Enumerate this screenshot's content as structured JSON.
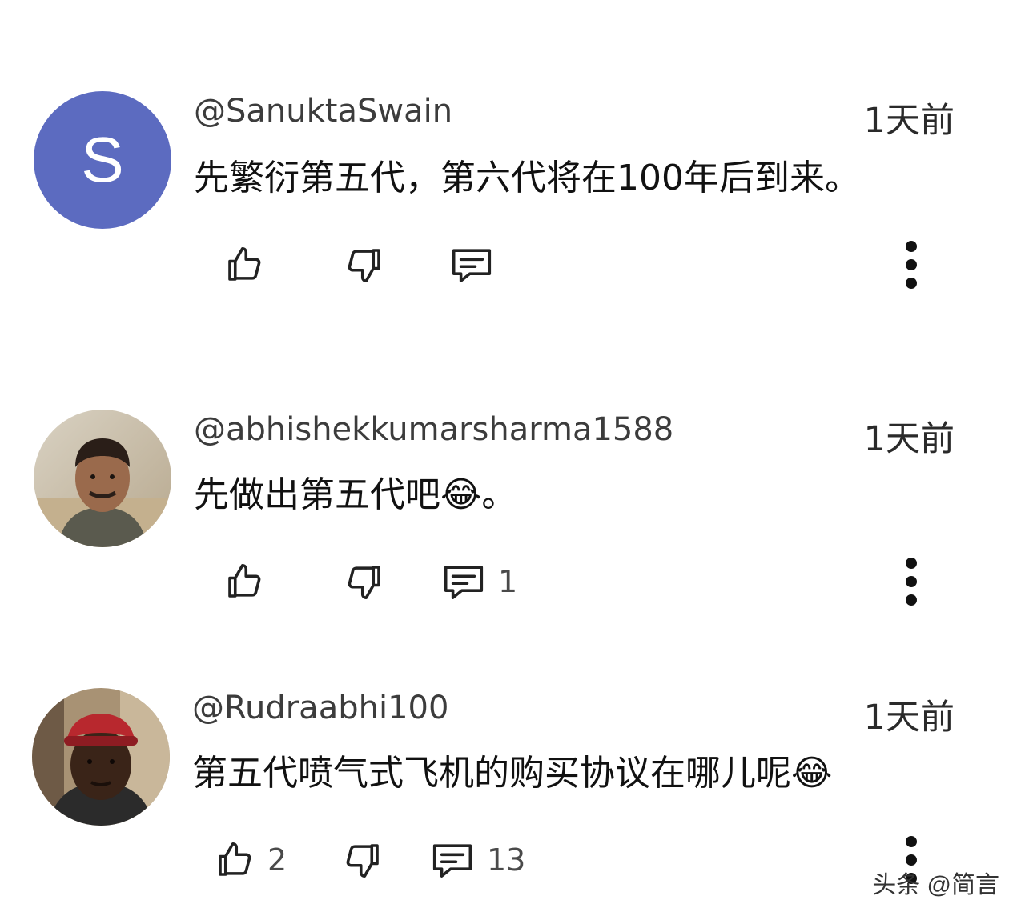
{
  "comments": [
    {
      "avatar_letter": "S",
      "avatar_color": "#5c6bc0",
      "handle": "@SanuktaSwain",
      "time": "1天前",
      "text": "先繁衍第五代，第六代将在100年后到来。",
      "likes": "",
      "replies": ""
    },
    {
      "avatar_letter": "",
      "handle": "@abhishekkumarsharma1588",
      "time": "1天前",
      "text": "先做出第五代吧😂。",
      "likes": "",
      "replies": "1"
    },
    {
      "avatar_letter": "",
      "handle": "@Rudraabhi100",
      "time": "1天前",
      "text": "第五代喷气式飞机的购买协议在哪儿呢😂",
      "likes": "2",
      "replies": "13"
    }
  ],
  "icons": {
    "like": "thumbs-up-icon",
    "dislike": "thumbs-down-icon",
    "reply": "comment-icon",
    "more": "more-vertical-icon"
  },
  "watermark": "头条 @简言"
}
